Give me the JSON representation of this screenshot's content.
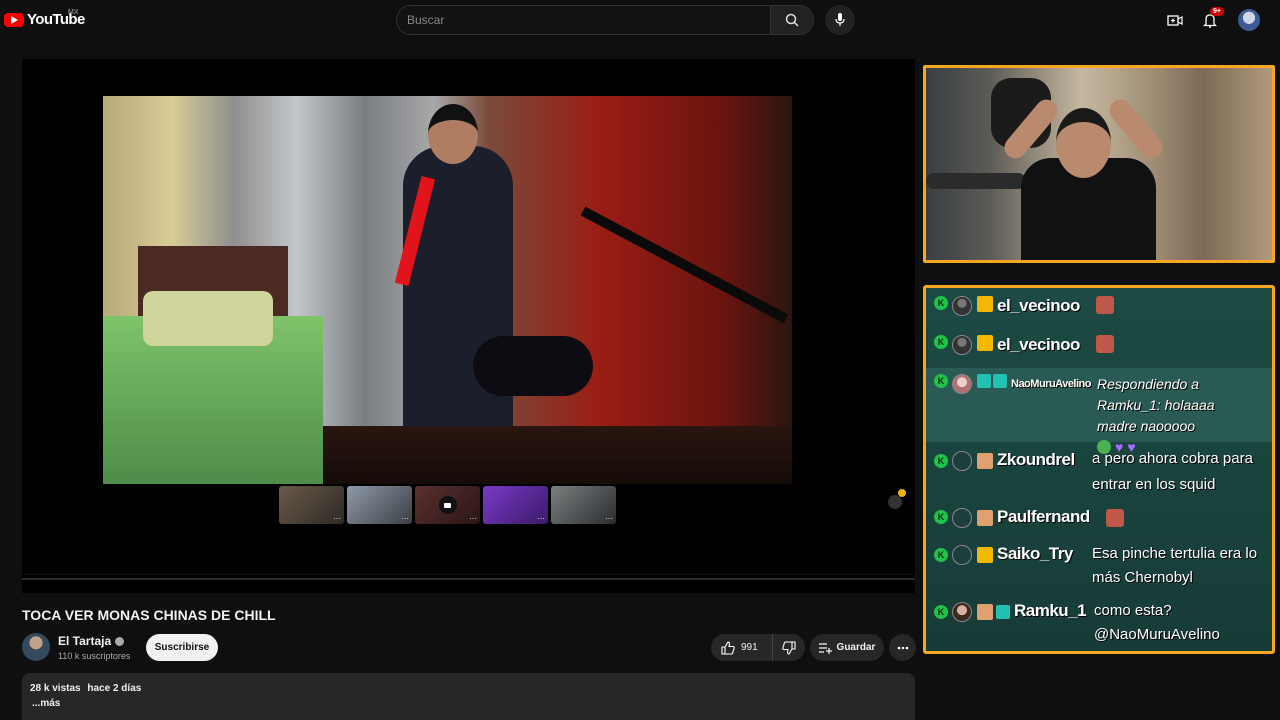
{
  "header": {
    "logo_text": "YouTube",
    "region": "MX",
    "search_placeholder": "Buscar",
    "notification_count": "9+",
    "icons": [
      "search-icon",
      "mic-icon",
      "create-icon",
      "bell-icon",
      "avatar"
    ]
  },
  "video": {
    "title": "TOCA VER MONAS CHINAS DE CHILL",
    "channel_name": "El Tartaja",
    "subscribers": "110 k suscriptores",
    "subscribe_label": "Suscribirse",
    "likes": "991",
    "save_label": "Guardar",
    "views": "28 k vistas",
    "date": "hace 2 días",
    "more_label": "...más"
  },
  "chat": {
    "messages": [
      {
        "user": "el_vecinoo",
        "text": ""
      },
      {
        "user": "el_vecinoo",
        "text": ""
      },
      {
        "user": "NaoMuruAvelino",
        "text": "Respondiendo a Ramku_1: holaaaa madre naooooo"
      },
      {
        "user": "Zkoundrel",
        "text": "a pero ahora cobra para entrar en los squid"
      },
      {
        "user": "Paulfernand",
        "text": ""
      },
      {
        "user": "Saiko_Try",
        "text": "Esa pinche tertulia era lo más Chernobyl"
      },
      {
        "user": "Ramku_1",
        "text": "como esta? @NaoMuruAvelino"
      }
    ]
  },
  "colors": {
    "overlay_border": "#f5a623",
    "chat_bg": "#1d4a44",
    "mod_badge": "#1fc34a",
    "brand_red": "#ff0000"
  }
}
